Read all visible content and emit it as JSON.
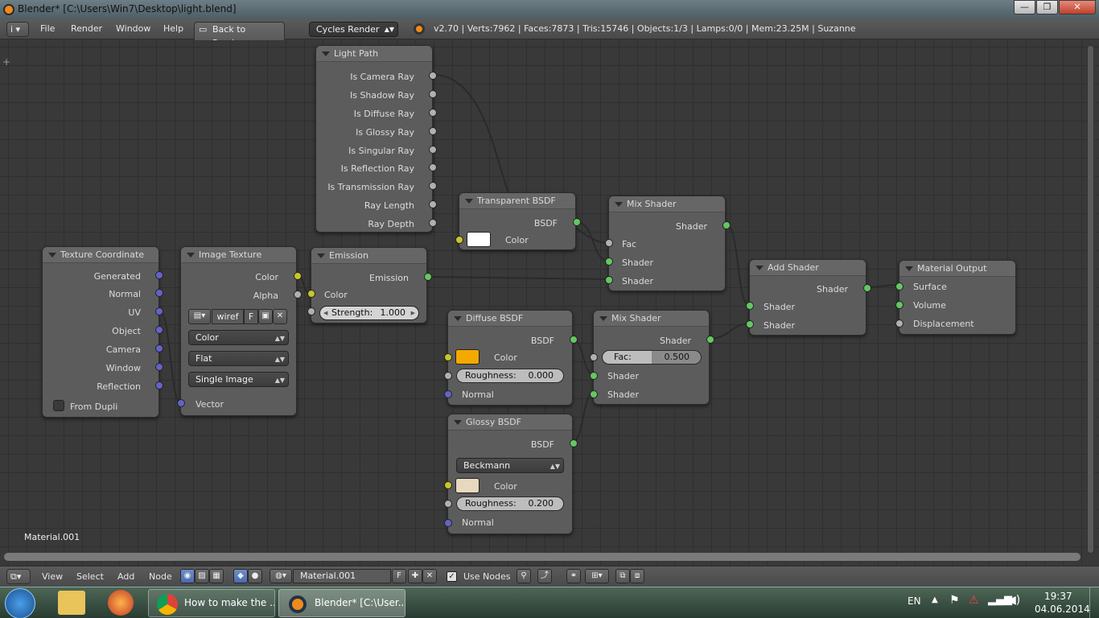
{
  "window": {
    "title": "Blender* [C:\\Users\\Win7\\Desktop\\light.blend]",
    "controls": {
      "minimize": "—",
      "maximize": "❐",
      "close": "✕"
    }
  },
  "top_menu": {
    "info_icon": "i",
    "items": [
      "File",
      "Render",
      "Window",
      "Help"
    ],
    "back_button": "Back to Previous",
    "render_engine": "Cycles Render",
    "stats": "v2.70 | Verts:7962 | Faces:7873 | Tris:15746 | Objects:1/3 | Lamps:0/0 | Mem:23.25M | Suzanne"
  },
  "nodes": {
    "light_path": {
      "title": "Light Path",
      "outputs": [
        "Is Camera Ray",
        "Is Shadow Ray",
        "Is Diffuse Ray",
        "Is Glossy Ray",
        "Is Singular Ray",
        "Is Reflection Ray",
        "Is Transmission Ray",
        "Ray Length",
        "Ray Depth"
      ]
    },
    "texture_coordinate": {
      "title": "Texture Coordinate",
      "outputs": [
        "Generated",
        "Normal",
        "UV",
        "Object",
        "Camera",
        "Window",
        "Reflection"
      ],
      "checkbox_label": "From Dupli"
    },
    "image_texture": {
      "title": "Image Texture",
      "outputs": [
        "Color",
        "Alpha"
      ],
      "image_name": "wiref",
      "fake_user": "F",
      "color_space": "Color",
      "projection": "Flat",
      "source": "Single Image",
      "input": "Vector"
    },
    "emission": {
      "title": "Emission",
      "output": "Emission",
      "color_label": "Color",
      "strength_label": "Strength:",
      "strength_value": "1.000"
    },
    "transparent_bsdf": {
      "title": "Transparent BSDF",
      "output": "BSDF",
      "color_label": "Color",
      "color": "#ffffff"
    },
    "mix_shader_1": {
      "title": "Mix Shader",
      "output": "Shader",
      "inputs": [
        "Fac",
        "Shader",
        "Shader"
      ]
    },
    "diffuse_bsdf": {
      "title": "Diffuse BSDF",
      "output": "BSDF",
      "color_label": "Color",
      "color": "#f4a900",
      "roughness_label": "Roughness:",
      "roughness_value": "0.000",
      "normal_label": "Normal"
    },
    "glossy_bsdf": {
      "title": "Glossy BSDF",
      "output": "BSDF",
      "distribution": "Beckmann",
      "color_label": "Color",
      "color": "#e8d8bd",
      "roughness_label": "Roughness:",
      "roughness_value": "0.200",
      "normal_label": "Normal"
    },
    "mix_shader_2": {
      "title": "Mix Shader",
      "output": "Shader",
      "fac_label": "Fac:",
      "fac_value": "0.500",
      "inputs": [
        "Shader",
        "Shader"
      ]
    },
    "add_shader": {
      "title": "Add Shader",
      "output": "Shader",
      "inputs": [
        "Shader",
        "Shader"
      ]
    },
    "material_output": {
      "title": "Material Output",
      "inputs": [
        "Surface",
        "Volume",
        "Displacement"
      ]
    }
  },
  "editor": {
    "material_label": "Material.001"
  },
  "bottom_bar": {
    "menus": [
      "View",
      "Select",
      "Add",
      "Node"
    ],
    "material_name": "Material.001",
    "fake_user": "F",
    "use_nodes_label": "Use Nodes"
  },
  "taskbar": {
    "tasks": [
      "How to make the ...",
      "Blender* [C:\\User..."
    ],
    "language": "EN",
    "time": "19:37",
    "date": "04.06.2014"
  },
  "colors": {
    "shader_socket": "#63c763",
    "color_socket": "#c7c729",
    "vector_socket": "#6363c7",
    "value_socket": "#b0b0b0",
    "accent_orange": "#f08a1c"
  }
}
